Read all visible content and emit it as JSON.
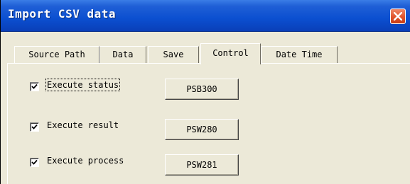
{
  "window": {
    "title": "Import CSV data"
  },
  "tabs": [
    {
      "label": "Source Path",
      "active": false
    },
    {
      "label": "Data",
      "active": false
    },
    {
      "label": "Save",
      "active": false
    },
    {
      "label": "Control",
      "active": true
    },
    {
      "label": "Date Time",
      "active": false
    }
  ],
  "control": {
    "rows": [
      {
        "label": "Execute status",
        "checked": true,
        "button": "PSB300"
      },
      {
        "label": "Execute result",
        "checked": true,
        "button": "PSW280"
      },
      {
        "label": "Execute process",
        "checked": true,
        "button": "PSW281"
      }
    ]
  },
  "colors": {
    "titlebar": "#0b4fd0",
    "close_button": "#e0542c",
    "dialog_face": "#ece9d8"
  }
}
